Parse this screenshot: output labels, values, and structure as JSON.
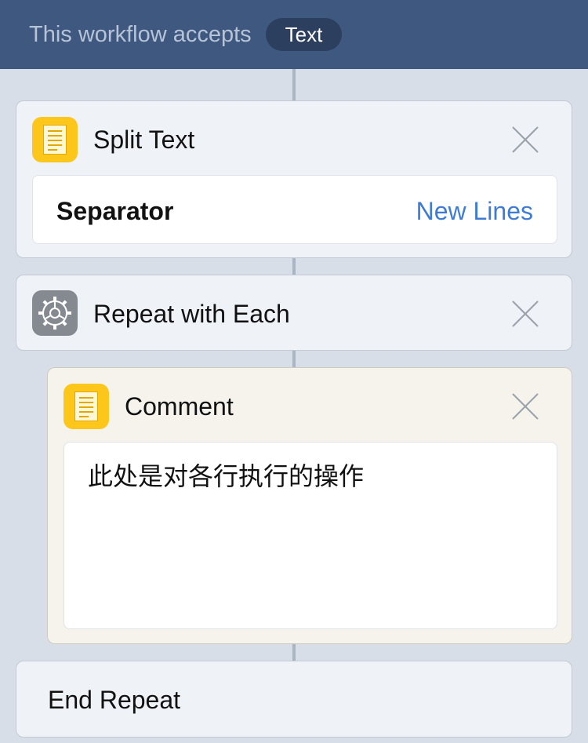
{
  "header": {
    "label": "This workflow accepts",
    "input_type": "Text"
  },
  "actions": {
    "split_text": {
      "title": "Split Text",
      "icon": "document-icon",
      "param_label": "Separator",
      "param_value": "New Lines"
    },
    "repeat": {
      "title": "Repeat with Each",
      "icon": "gear-icon"
    },
    "comment": {
      "title": "Comment",
      "icon": "document-icon",
      "text": "此处是对各行执行的操作"
    },
    "end_repeat": {
      "title": "End Repeat"
    }
  },
  "colors": {
    "header_bg": "#3e5880",
    "accent_link": "#3e7bd6",
    "icon_yellow": "#fcc61a",
    "icon_gray": "#858a91"
  }
}
